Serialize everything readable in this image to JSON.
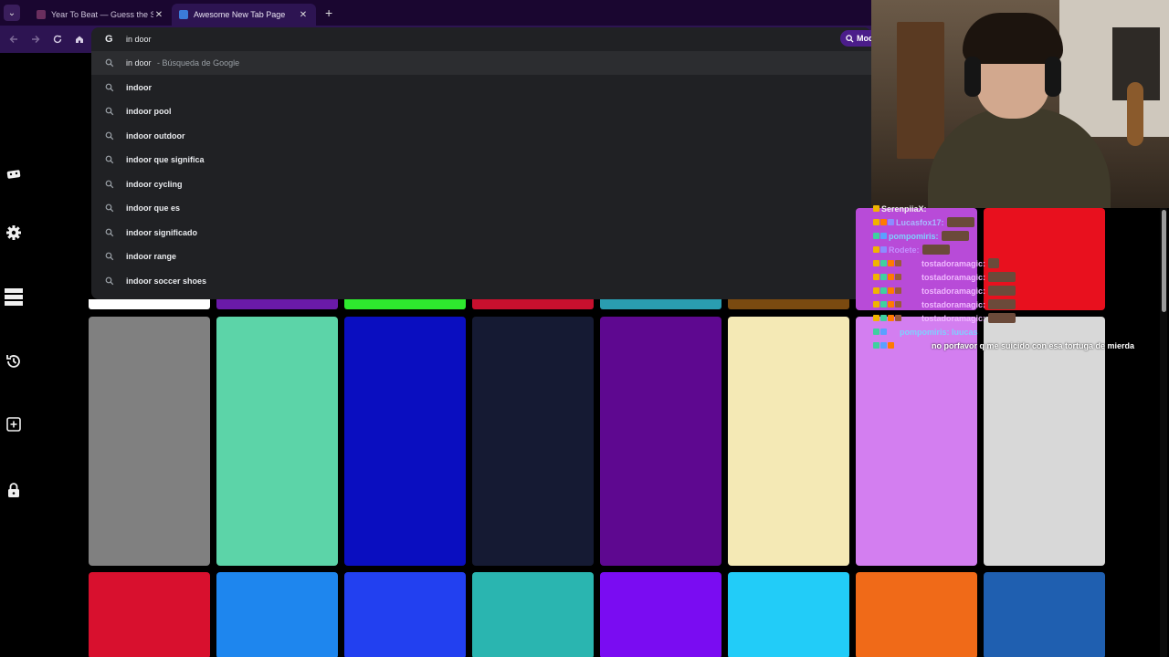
{
  "browser": {
    "tabs": [
      {
        "title": "Year To Beat — Guess the Song",
        "active": false,
        "favicon_color": "#6b2e5e"
      },
      {
        "title": "Awesome New Tab Page",
        "active": true,
        "favicon_color": "#3b7bd8"
      }
    ],
    "close_glyph": "✕",
    "new_tab_glyph": "+"
  },
  "toolbar": {
    "back_icon": "back-arrow-icon",
    "forward_icon": "forward-arrow-icon",
    "reload_icon": "reload-icon",
    "home_icon": "home-icon",
    "mode_label": "Mod"
  },
  "omnibox": {
    "logo_glyph": "G",
    "value": "in door"
  },
  "suggestions": [
    {
      "text": "in door",
      "sub": " -  Búsqueda de Google"
    },
    {
      "text": "indoor",
      "sub": ""
    },
    {
      "text": "indoor pool",
      "sub": ""
    },
    {
      "text": "indoor outdoor",
      "sub": ""
    },
    {
      "text": "indoor que significa",
      "sub": ""
    },
    {
      "text": "indoor cycling",
      "sub": ""
    },
    {
      "text": "indoor que es",
      "sub": ""
    },
    {
      "text": "indoor significado",
      "sub": ""
    },
    {
      "text": "indoor range",
      "sub": ""
    },
    {
      "text": "indoor soccer shoes",
      "sub": ""
    }
  ],
  "sidebar": [
    {
      "name": "gamepad-icon"
    },
    {
      "name": "gear-icon"
    },
    {
      "name": "list-icon"
    },
    {
      "name": "history-icon"
    },
    {
      "name": "add-box-icon"
    },
    {
      "name": "lock-icon"
    }
  ],
  "tiles": {
    "strip_colors": [
      "#ffffff",
      "#6a1aa8",
      "#2ee82e",
      "#c8102e",
      "#2a9db0",
      "#7a4a10",
      "#a13ec7",
      "#ffffff"
    ],
    "row1_colors": [
      "#808080",
      "#5cd4a8",
      "#0a0ec0",
      "#151a33",
      "#5e0890",
      "#f4e9b5",
      "#d37ef0",
      "#d8d8d8"
    ],
    "row2_colors": [
      "#d8102e",
      "#1e86ee",
      "#2240f0",
      "#2ab5b0",
      "#7a0cf2",
      "#22ccf8",
      "#f06a18",
      "#1f5fb0"
    ],
    "red_tile_color": "#e8101e"
  },
  "chat": [
    {
      "user": "SerenpiiaX:",
      "color": "#f0f0f0",
      "msg": ""
    },
    {
      "user": "Lucasfox17:",
      "color": "#a8b8ff",
      "msg": ""
    },
    {
      "user": "pompomiris:",
      "color": "#7fd0ff",
      "msg": ""
    },
    {
      "user": "Rodete:",
      "color": "#c490ff",
      "msg": ""
    },
    {
      "user": "tostadoramagic:",
      "color": "#f0b8ff",
      "msg": ""
    },
    {
      "user": "tostadoramagic:",
      "color": "#f0b8ff",
      "msg": ""
    },
    {
      "user": "tostadoramagic:",
      "color": "#f0b8ff",
      "msg": ""
    },
    {
      "user": "tostadoramagic:",
      "color": "#f0b8ff",
      "msg": ""
    },
    {
      "user": "tostadoramagic:",
      "color": "#f0b8ff",
      "msg": ""
    },
    {
      "user": "pompomiris: luucas",
      "color": "#7fd0ff",
      "msg": ""
    },
    {
      "user": "",
      "color": "#ffffff",
      "msg": "no porfavor q me suicido con esa tortuga de mierda"
    }
  ]
}
